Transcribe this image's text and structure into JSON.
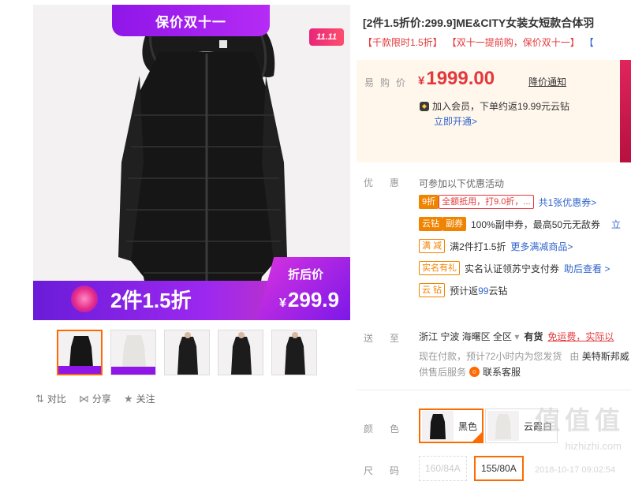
{
  "gallery": {
    "ribbon": "保价双十一",
    "badge": "11.11",
    "promo_left": "2件1.5折",
    "promo_tag": "折后价",
    "promo_currency": "¥",
    "promo_price": "299.9",
    "thumb_count": 5
  },
  "actions": [
    {
      "icon": "compare-icon",
      "glyph": "⇅",
      "label": "对比"
    },
    {
      "icon": "share-icon",
      "glyph": "⋈",
      "label": "分享"
    },
    {
      "icon": "star-icon",
      "glyph": "★",
      "label": "关注"
    }
  ],
  "product": {
    "title": "[2件1.5折价:299.9]ME&CITY女装女短款合体羽",
    "subtitle_1": "【千款限时1.5折】",
    "subtitle_2": "【双十一提前购，保价双十一】",
    "subtitle_3": "【"
  },
  "price": {
    "label": "易购价",
    "currency": "¥",
    "amount": "1999.00",
    "notice": "降价通知",
    "vip_icon": "vip-icon",
    "vip_text": "加入会员，下单约返19.99元云钻",
    "vip_link": "立即开通>"
  },
  "promotions": {
    "label": "优惠",
    "intro": "可参加以下优惠活动",
    "rows": [
      {
        "tags": [
          {
            "text": "9折",
            "style": "fill"
          },
          {
            "text": "全额抵用，打9.0折，...",
            "style": "red"
          }
        ],
        "text": "",
        "link": "共1张优惠券>"
      },
      {
        "tags": [
          {
            "text": "云钻",
            "style": "fill"
          },
          {
            "text": "副券",
            "style": "dark"
          }
        ],
        "text": "100%副申券，最高50元无敌券",
        "link": "立"
      },
      {
        "tags": [
          {
            "text": "满 减",
            "style": "plain"
          }
        ],
        "text": "满2件打1.5折",
        "link": "更多满减商品>"
      },
      {
        "tags": [
          {
            "text": "实名有礼",
            "style": "plain"
          }
        ],
        "text": "实名认证领苏宁支付券",
        "link": "助后查看 >"
      },
      {
        "tags": [
          {
            "text": "云 钻",
            "style": "plain"
          }
        ],
        "text_pre": "预计返",
        "num": "99",
        "text_post": "云钻"
      }
    ]
  },
  "delivery": {
    "label": "送至",
    "address": "浙江  宁波  海曙区  全区",
    "stock": "有货",
    "freight": "免运费，实际以",
    "ship_text": "现在付款，预计72小时内为您发货",
    "ship_by": "由",
    "seller": "美特斯邦威",
    "service_label": "供售后服务",
    "service_link": "联系客服"
  },
  "colors": {
    "label": "颜色",
    "options": [
      {
        "name": "黑色",
        "selected": true
      },
      {
        "name": "云霞白",
        "selected": false
      }
    ]
  },
  "sizes": {
    "label": "尺码",
    "options": [
      {
        "name": "160/84A",
        "state": "disabled"
      },
      {
        "name": "155/80A",
        "state": "selected"
      }
    ]
  },
  "watermark": {
    "text": "值值值",
    "site": "hizhizhi.com",
    "id": "2018-10-17 09:02:54"
  }
}
